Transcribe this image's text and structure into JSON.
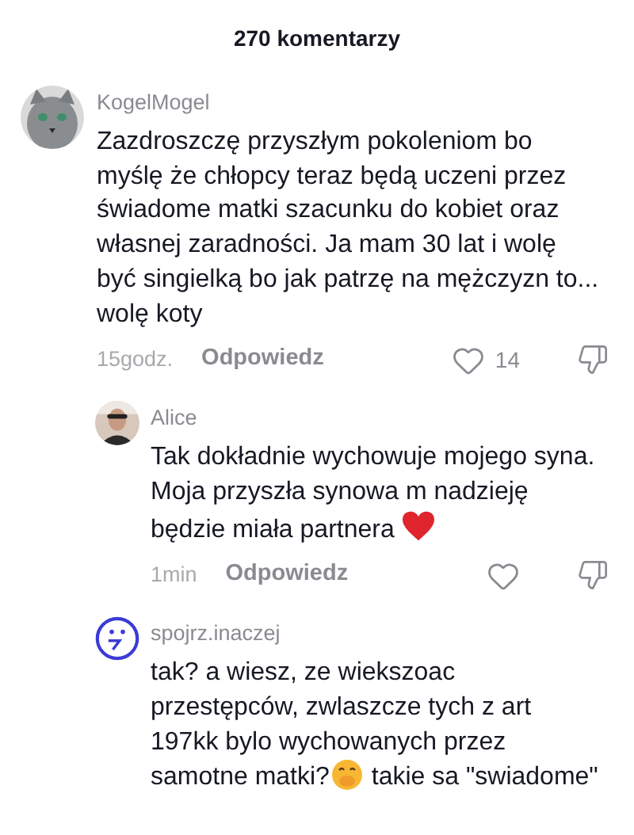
{
  "header": {
    "title": "270 komentarzy"
  },
  "comments": [
    {
      "kind": "comment",
      "avatar": {
        "kind": "cat"
      },
      "author": "KogelMogel",
      "parts": [
        {
          "kind": "text",
          "text": "Zazdroszczę przyszłym pokoleniom bo myślę że chłopcy teraz będą uczeni przez świadome matki szacunku do kobiet oraz własnej zaradności. Ja mam 30 lat i wolę być singielką bo jak patrzę na mężczyzn to... wolę koty"
        }
      ],
      "time": "15godz.",
      "reply": "Odpowiedz",
      "likes": "14",
      "liked": false
    },
    {
      "kind": "reply",
      "avatar": {
        "kind": "person"
      },
      "author": "Alice",
      "parts": [
        {
          "kind": "text",
          "text": "Tak dokładnie wychowuje mojego syna. Moja przyszła synowa m nadzieję będzie miała partnera "
        },
        {
          "kind": "heart"
        }
      ],
      "time": "1min",
      "reply": "Odpowiedz",
      "liked": false
    },
    {
      "kind": "reply",
      "avatar": {
        "kind": "drawing"
      },
      "author": "spojrz.inaczej",
      "parts": [
        {
          "kind": "text",
          "text": "tak? a wiesz, ze wiekszoac przestępców, zwlaszcze tych z art 197kk bylo wychowanych przez samotne matki?"
        },
        {
          "kind": "giggle"
        },
        {
          "kind": "text",
          "text": " takie sa \"swiadome\""
        }
      ]
    }
  ]
}
